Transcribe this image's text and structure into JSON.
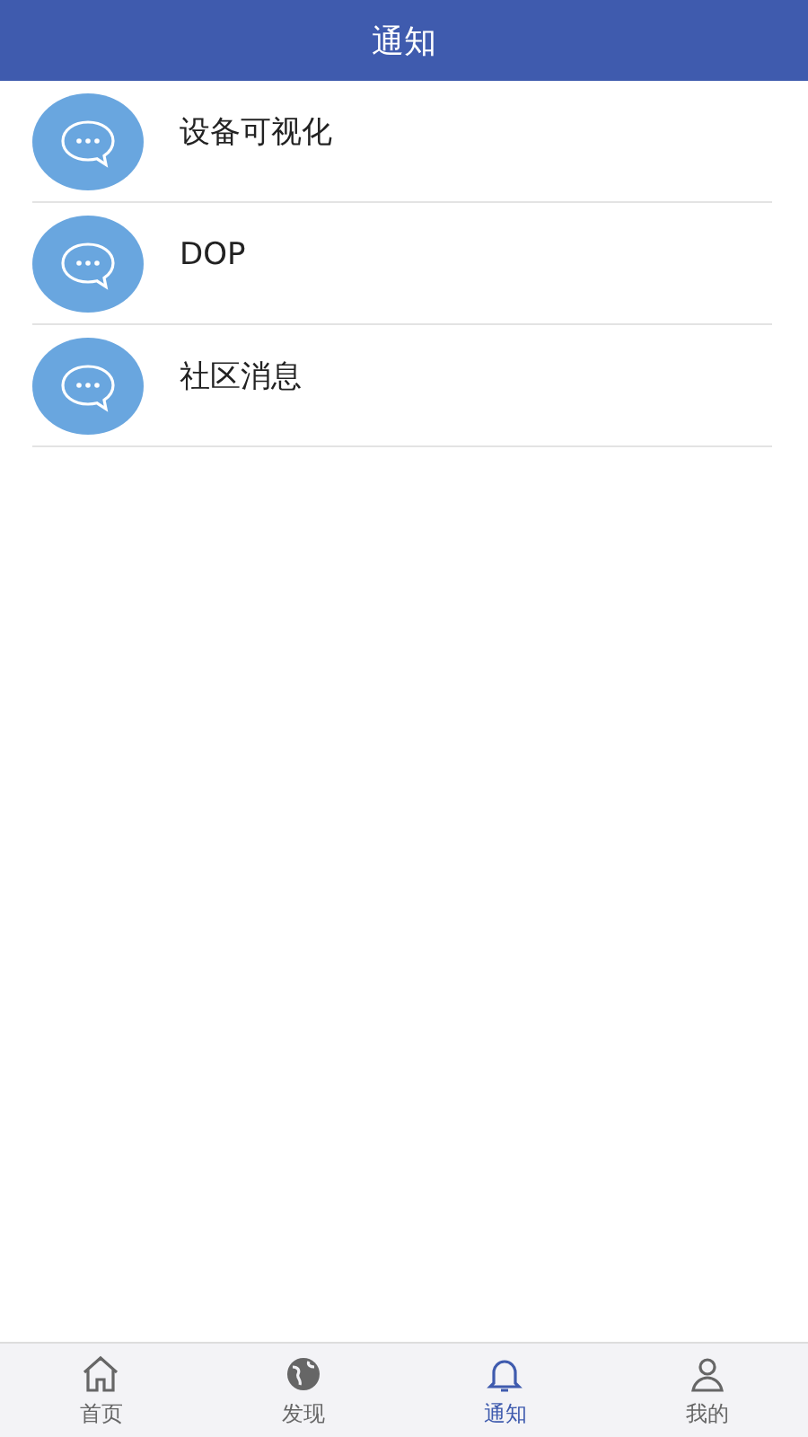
{
  "header": {
    "title": "通知"
  },
  "messages": [
    {
      "title": "设备可视化"
    },
    {
      "title": "DOP"
    },
    {
      "title": "社区消息"
    }
  ],
  "tabs": [
    {
      "label": "首页",
      "kind": "home",
      "selected": false
    },
    {
      "label": "发现",
      "kind": "globe",
      "selected": false
    },
    {
      "label": "通知",
      "kind": "bell",
      "selected": true
    },
    {
      "label": "我的",
      "kind": "person",
      "selected": false
    }
  ]
}
